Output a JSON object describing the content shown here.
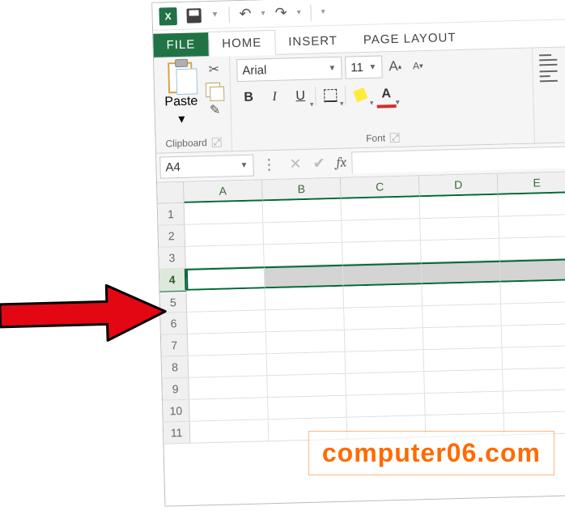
{
  "qat": {
    "app_glyph": "X"
  },
  "tabs": {
    "file": "FILE",
    "home": "HOME",
    "insert": "INSERT",
    "pagelayout": "PAGE LAYOUT"
  },
  "ribbon": {
    "clipboard": {
      "paste_label": "Paste",
      "group_label": "Clipboard"
    },
    "font": {
      "font_name": "Arial",
      "font_size": "11",
      "bold": "B",
      "italic": "I",
      "underline": "U",
      "fontcolor_glyph": "A",
      "bigA": "A",
      "smallA": "A",
      "group_label": "Font"
    }
  },
  "namebox": {
    "value": "A4"
  },
  "formulabar": {
    "fx_label": "fx"
  },
  "grid": {
    "columns": [
      "A",
      "B",
      "C",
      "D",
      "E"
    ],
    "rows": [
      "1",
      "2",
      "3",
      "4",
      "5",
      "6",
      "7",
      "8",
      "9",
      "10",
      "11"
    ],
    "selected_row_index": 3
  },
  "watermark": "computer06.com"
}
